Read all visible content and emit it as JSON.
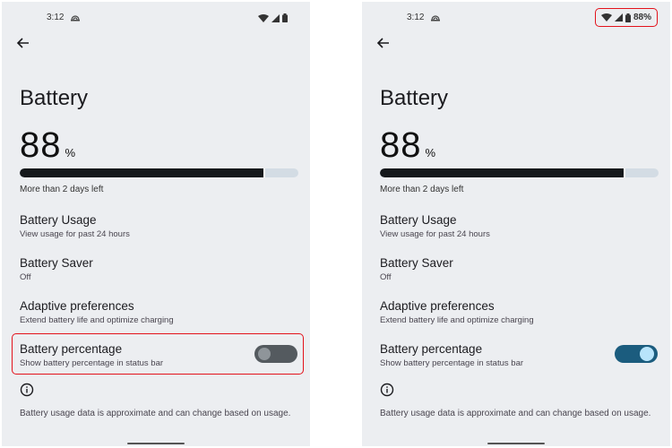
{
  "panels": [
    {
      "variant": "before",
      "status_bar": {
        "time": "3:12",
        "icons": [
          "cast-icon",
          "wifi-icon",
          "signal-icon",
          "battery-icon"
        ],
        "battery_percent_text": ""
      },
      "page_title": "Battery",
      "battery": {
        "level_value": "88",
        "level_unit": "%",
        "fill_percent": 88,
        "time_left": "More than 2 days left"
      },
      "settings": [
        {
          "title": "Battery Usage",
          "subtitle": "View usage for past 24 hours"
        },
        {
          "title": "Battery Saver",
          "subtitle": "Off"
        },
        {
          "title": "Adaptive preferences",
          "subtitle": "Extend battery life and optimize charging"
        },
        {
          "title": "Battery percentage",
          "subtitle": "Show battery percentage in status bar",
          "toggle": "off"
        }
      ],
      "footer": "Battery usage data is approximate and can change based on usage.",
      "highlight": "battery-percentage-row"
    },
    {
      "variant": "after",
      "status_bar": {
        "time": "3:12",
        "icons": [
          "cast-icon",
          "wifi-icon",
          "signal-icon",
          "battery-icon"
        ],
        "battery_percent_text": "88%"
      },
      "page_title": "Battery",
      "battery": {
        "level_value": "88",
        "level_unit": "%",
        "fill_percent": 88,
        "time_left": "More than 2 days left"
      },
      "settings": [
        {
          "title": "Battery Usage",
          "subtitle": "View usage for past 24 hours"
        },
        {
          "title": "Battery Saver",
          "subtitle": "Off"
        },
        {
          "title": "Adaptive preferences",
          "subtitle": "Extend battery life and optimize charging"
        },
        {
          "title": "Battery percentage",
          "subtitle": "Show battery percentage in status bar",
          "toggle": "on"
        }
      ],
      "footer": "Battery usage data is approximate and can change based on usage.",
      "highlight": "status-bar-icons"
    }
  ],
  "colors": {
    "highlight": "#e3121b",
    "toggle_on_track": "#1b5c7e",
    "toggle_on_knob": "#b8e4fb",
    "toggle_off_track": "#545a5f",
    "toggle_off_knob": "#8f959a",
    "background": "#eceef1"
  }
}
